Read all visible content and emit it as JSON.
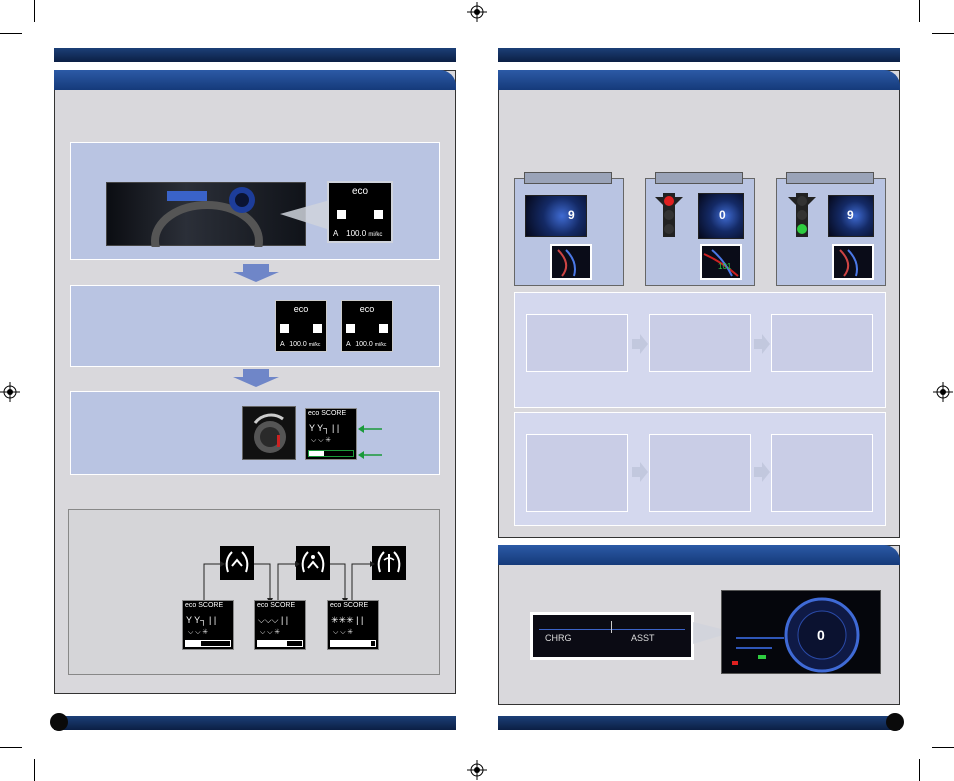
{
  "colors": {
    "header_blue": "#1f4a93",
    "panel_grey": "#d9d8dc",
    "box_blue": "#b9c4e2",
    "accent_green": "#1a9a3a",
    "signal_red": "#e02020",
    "signal_green": "#2ecc40"
  },
  "left_page": {
    "eco_label_1": "eco",
    "eco_value_1": "100.0",
    "eco_unit_1": "mi/kc",
    "eco_prefix_1": "A",
    "eco_label_2": "eco",
    "eco_value_2": "100.0",
    "eco_unit_2": "mi/kc",
    "eco_prefix_2": "A",
    "eco_label_3": "eco",
    "eco_value_3": "100.0",
    "eco_unit_3": "mi/kc",
    "eco_prefix_3": "A",
    "score_label": "eco SCORE",
    "score_fill": 0.35,
    "score_cards": [
      {
        "label": "eco SCORE",
        "fill": 0.35
      },
      {
        "label": "eco SCORE",
        "fill": 0.65
      },
      {
        "label": "eco SCORE",
        "fill": 0.9
      }
    ]
  },
  "right_page": {
    "gauge_readouts": [
      "9",
      "0",
      "9"
    ],
    "green_readout": "101",
    "chrg_label": "CHRG",
    "asst_label": "ASST",
    "cluster_speed": "0"
  },
  "icons": [
    "registration-mark",
    "wreath-icon",
    "leaf-icon",
    "traffic-light-icon",
    "arrow-right-icon",
    "arrow-down-icon"
  ]
}
